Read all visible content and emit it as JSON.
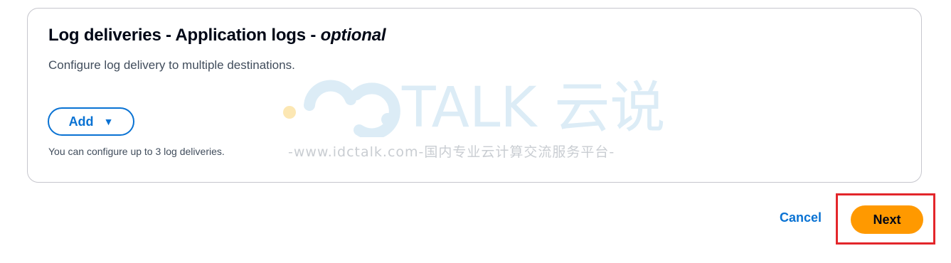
{
  "panel": {
    "title_main": "Log deliveries - Application logs - ",
    "title_optional": "optional",
    "description": "Configure log delivery to multiple destinations.",
    "add_label": "Add",
    "add_icon": "caret-down-icon",
    "hint": "You can configure up to 3 log deliveries."
  },
  "watermark": {
    "logo_text": "TALK 云说",
    "url_text": "-www.idctalk.com-国内专业云计算交流服务平台-"
  },
  "footer": {
    "cancel_label": "Cancel",
    "next_label": "Next"
  },
  "colors": {
    "accent": "#0972d3",
    "primary_button": "#ff9900",
    "highlight_box": "#e3262b"
  }
}
